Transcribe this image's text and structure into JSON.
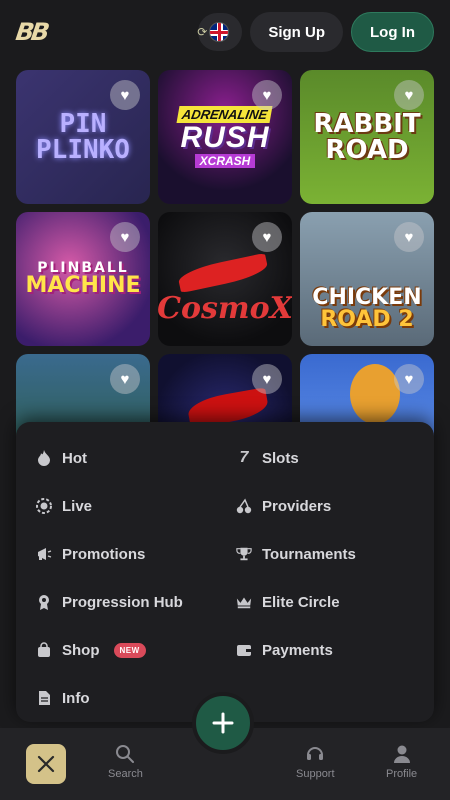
{
  "header": {
    "logo": "BB",
    "sign_up_label": "Sign Up",
    "log_in_label": "Log In"
  },
  "games": [
    {
      "line1": "PIN",
      "line2": "PLINKO"
    },
    {
      "line1": "ADRENALINE",
      "line2": "RUSH",
      "line3": "XCRASH"
    },
    {
      "line1": "RABBIT",
      "line2": "ROAD"
    },
    {
      "line1": "PLINBALL",
      "line2": "MACHINE"
    },
    {
      "line1": "CosmoX"
    },
    {
      "line1": "CHICKEN",
      "line2": "ROAD 2"
    }
  ],
  "menu": {
    "items": [
      {
        "label": "Hot",
        "icon": "flame-icon"
      },
      {
        "label": "Slots",
        "icon": "seven-icon"
      },
      {
        "label": "Live",
        "icon": "live-chip-icon"
      },
      {
        "label": "Providers",
        "icon": "cherry-icon"
      },
      {
        "label": "Promotions",
        "icon": "megaphone-icon"
      },
      {
        "label": "Tournaments",
        "icon": "trophy-icon"
      },
      {
        "label": "Progression Hub",
        "icon": "medal-icon"
      },
      {
        "label": "Elite Circle",
        "icon": "crown-icon"
      },
      {
        "label": "Shop",
        "icon": "bag-icon",
        "badge": "NEW"
      },
      {
        "label": "Payments",
        "icon": "wallet-icon"
      },
      {
        "label": "Info",
        "icon": "document-icon"
      }
    ]
  },
  "bottom_nav": {
    "search_label": "Search",
    "support_label": "Support",
    "profile_label": "Profile"
  },
  "colors": {
    "background": "#1b1b1d",
    "accent_green": "#1f5a45",
    "close_button": "#d4c289",
    "new_badge": "#d94a5a"
  }
}
